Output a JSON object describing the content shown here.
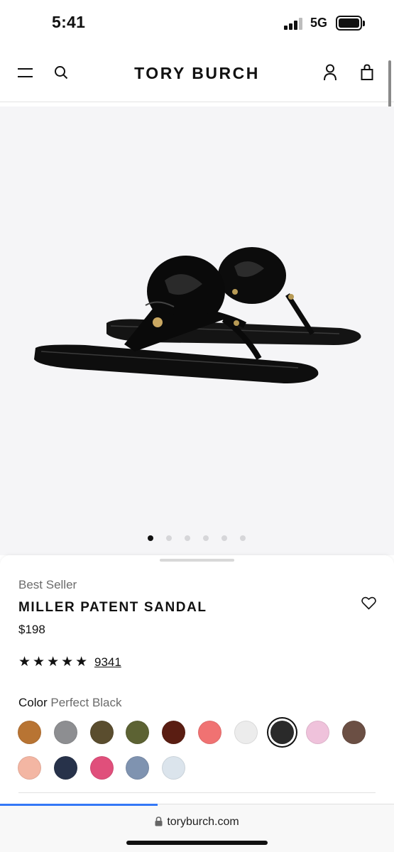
{
  "status_bar": {
    "time": "5:41",
    "network": "5G"
  },
  "header": {
    "brand": "TORY BURCH",
    "menu_icon": "hamburger-menu-icon",
    "search_icon": "search-icon",
    "account_icon": "account-icon",
    "bag_icon": "shopping-bag-icon"
  },
  "gallery": {
    "image_count": 6,
    "active_index": 0
  },
  "product": {
    "badge": "Best Seller",
    "name": "MILLER PATENT SANDAL",
    "price": "$198",
    "stars": "★★★★★",
    "rating": 5,
    "review_count": "9341",
    "color_label": "Color",
    "color_value": "Perfect Black",
    "wishlist_icon": "heart-icon"
  },
  "swatches": [
    {
      "name": "tan",
      "color": "#b87433"
    },
    {
      "name": "gray",
      "color": "#8d8e91"
    },
    {
      "name": "gold-multi",
      "color": "#5a4d2e"
    },
    {
      "name": "olive",
      "color": "#5c6233"
    },
    {
      "name": "brown-leather",
      "color": "#5a1d12"
    },
    {
      "name": "coral",
      "color": "#f07272"
    },
    {
      "name": "white",
      "color": "#ececec"
    },
    {
      "name": "perfect-black",
      "color": "#2a2a2a",
      "selected": true
    },
    {
      "name": "light-pink",
      "color": "#efc2db"
    },
    {
      "name": "brown",
      "color": "#6b4f44"
    },
    {
      "name": "blush",
      "color": "#f3b6a3"
    },
    {
      "name": "navy",
      "color": "#27324a"
    },
    {
      "name": "pink",
      "color": "#e04f7b"
    },
    {
      "name": "blue-gray",
      "color": "#7f93b0"
    },
    {
      "name": "pale-blue",
      "color": "#dbe4ec"
    }
  ],
  "browser": {
    "url": "toryburch.com",
    "lock_icon": "lock-icon",
    "progress": 0.4
  }
}
